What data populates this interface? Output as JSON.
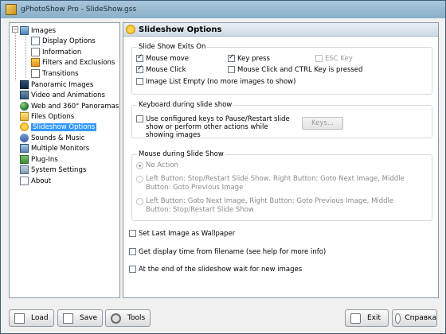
{
  "window": {
    "title": "gPhotoShow Pro - SlideShow.gss"
  },
  "tree": {
    "items": [
      {
        "label": "Images",
        "icon": "images-icon"
      },
      {
        "label": "Display Options",
        "icon": "display-options-icon"
      },
      {
        "label": "Information",
        "icon": "information-icon"
      },
      {
        "label": "Filters and Exclusions",
        "icon": "filters-icon"
      },
      {
        "label": "Transitions",
        "icon": "transitions-icon"
      },
      {
        "label": "Panoramic Images",
        "icon": "panoramic-icon"
      },
      {
        "label": "Video and Animations",
        "icon": "video-icon"
      },
      {
        "label": "Web and 360° Panoramas",
        "icon": "globe-icon"
      },
      {
        "label": "Files Options",
        "icon": "folder-icon"
      },
      {
        "label": "Slideshow Options",
        "icon": "slideshow-icon"
      },
      {
        "label": "Sounds & Music",
        "icon": "music-icon"
      },
      {
        "label": "Multiple Monitors",
        "icon": "monitors-icon"
      },
      {
        "label": "Plug-Ins",
        "icon": "plugin-icon"
      },
      {
        "label": "System Settings",
        "icon": "system-settings-icon"
      },
      {
        "label": "About",
        "icon": "about-icon"
      }
    ]
  },
  "panel": {
    "title": "Slideshow Options",
    "exits": {
      "title": "Slide Show Exits On",
      "mouse_move": "Mouse move",
      "key_press": "Key press",
      "esc_key": "ESC Key",
      "mouse_click": "Mouse Click",
      "mouse_click_ctrl": "Mouse Click and CTRL Key is pressed",
      "image_list_empty": "Image List Empty (no more images to show)"
    },
    "keyboard": {
      "title": "Keyboard during slide show",
      "use_keys": "Use configured keys to Pause/Restart slide show or perform other actions while showing images",
      "keys_button": "Keys..."
    },
    "mouse": {
      "title": "Mouse during Slide Show",
      "no_action": "No Action",
      "option1": "Left Button: Stop/Restart Slide Show, Right Button: Goto Next Image, Middle Button: Goto Previous Image",
      "option2": "Left Button: Goto Next Image, Right Button: Goto Previous Image, Middle Button: Stop/Restart Slide Show"
    },
    "set_wallpaper": "Set Last Image as Wallpaper",
    "display_time": "Get display time from filename (see help for more info)",
    "wait_new_images": "At the end of the slideshow wait for new images"
  },
  "buttons": {
    "load": "Load",
    "save": "Save",
    "tools": "Tools",
    "exit": "Exit",
    "help": "Справка"
  }
}
